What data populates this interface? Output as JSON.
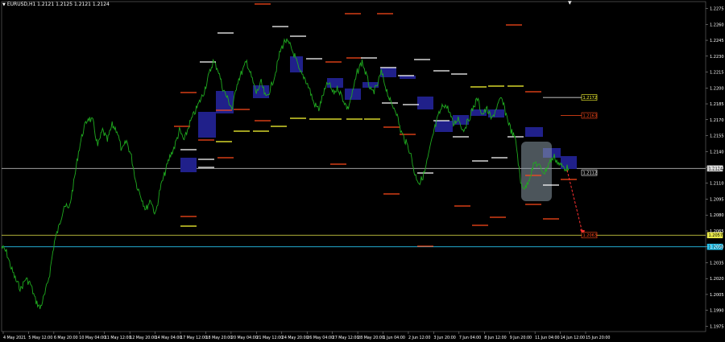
{
  "window": {
    "title": "EURUSD,H1  1.2121 1.2125 1.2121 1.2124"
  },
  "colors": {
    "background": "#000000",
    "price_line": "#1faa1f",
    "grid_text": "#ffffff",
    "axis": "#ffffff",
    "zone_blue": "#20208a",
    "level_red": "#ff4a1a",
    "level_white": "#ffffff",
    "level_yellow": "#ffff33",
    "hline_gray": "#b8b8b8",
    "hline_yellow": "#e8e84a",
    "hline_cyan": "#29c4ee",
    "highlight": "#8a9aa6"
  },
  "chart_data": {
    "type": "line",
    "symbol": "EURUSD",
    "timeframe": "H1",
    "ylim": [
      1.197,
      1.228
    ],
    "y_ticks": [
      "1.2275",
      "1.2260",
      "1.2245",
      "1.2230",
      "1.2215",
      "1.2200",
      "1.2185",
      "1.2170",
      "1.2155",
      "1.2140",
      "1.2125",
      "1.2110",
      "1.2095",
      "1.2080",
      "1.2065",
      "1.2050",
      "1.2035",
      "1.2020",
      "1.2005",
      "1.1990",
      "1.1975"
    ],
    "x_ticks": [
      "4 May 2021",
      "5 May 12:00",
      "6 May 20:00",
      "10 May 04:00",
      "11 May 12:00",
      "12 May 20:00",
      "14 May 04:00",
      "17 May 12:00",
      "18 May 20:00",
      "20 May 04:00",
      "21 May 12:00",
      "24 May 20:00",
      "26 May 04:00",
      "27 May 12:00",
      "28 May 20:00",
      "1 Jun 04:00",
      "2 Jun 12:00",
      "3 Jun 20:00",
      "7 Jun 04:00",
      "8 Jun 12:00",
      "9 Jun 20:00",
      "11 Jun 04:00",
      "14 Jun 12:00",
      "15 Jun 20:00"
    ],
    "series": [
      {
        "values": [
          1.205,
          1.2045,
          1.203,
          1.2018,
          1.201,
          1.202,
          1.2015,
          1.2,
          1.1992,
          1.2005,
          1.2025,
          1.2055,
          1.207,
          1.209,
          1.2085,
          1.211,
          1.214,
          1.216,
          1.2172,
          1.2168,
          1.2145,
          1.216,
          1.215,
          1.2165,
          1.216,
          1.214,
          1.215,
          1.2135,
          1.211,
          1.2098,
          1.2085,
          1.2095,
          1.208,
          1.2105,
          1.212,
          1.2135,
          1.2145,
          1.216,
          1.215,
          1.2165,
          1.2175,
          1.2185,
          1.2195,
          1.221,
          1.2225,
          1.2218,
          1.22,
          1.219,
          1.218,
          1.2205,
          1.2215,
          1.2225,
          1.221,
          1.2195,
          1.2205,
          1.219,
          1.22,
          1.2215,
          1.2235,
          1.2245,
          1.224,
          1.223,
          1.2215,
          1.221,
          1.22,
          1.2185,
          1.218,
          1.2195,
          1.2205,
          1.2195,
          1.22,
          1.219,
          1.218,
          1.2195,
          1.2215,
          1.2225,
          1.221,
          1.2195,
          1.22,
          1.2215,
          1.22,
          1.2185,
          1.218,
          1.216,
          1.215,
          1.214,
          1.2118,
          1.211,
          1.212,
          1.214,
          1.216,
          1.2175,
          1.2185,
          1.218,
          1.2165,
          1.2172,
          1.216,
          1.2168,
          1.218,
          1.219,
          1.2175,
          1.218,
          1.217,
          1.2182,
          1.219,
          1.2175,
          1.216,
          1.215,
          1.211,
          1.2105,
          1.2118,
          1.213,
          1.2125,
          1.212,
          1.213,
          1.2135,
          1.2128,
          1.2125,
          1.2124
        ]
      }
    ],
    "current_price": "1.2124",
    "tags": [
      {
        "label": "1.2172",
        "price": 1.2191,
        "color": "yellow"
      },
      {
        "label": "1.2163",
        "price": 1.2174,
        "color": "red"
      },
      {
        "label": "1.2112",
        "price": 1.212,
        "color": "white"
      },
      {
        "label": "1.2063",
        "price": 1.2061,
        "color": "red"
      },
      {
        "label": "1.2057",
        "price": 1.2061,
        "color": "yellow"
      },
      {
        "label": "1.2036",
        "price": 1.205,
        "color": "cyan"
      },
      {
        "label": "1.2124",
        "price": 1.2124,
        "color": "gray"
      }
    ],
    "horizontal_lines": [
      {
        "price": 1.2124,
        "color": "gray"
      },
      {
        "price": 1.2061,
        "color": "yellow"
      },
      {
        "price": 1.205,
        "color": "cyan"
      }
    ],
    "projection": {
      "from_price": 1.2124,
      "to_price": 1.2061
    }
  }
}
